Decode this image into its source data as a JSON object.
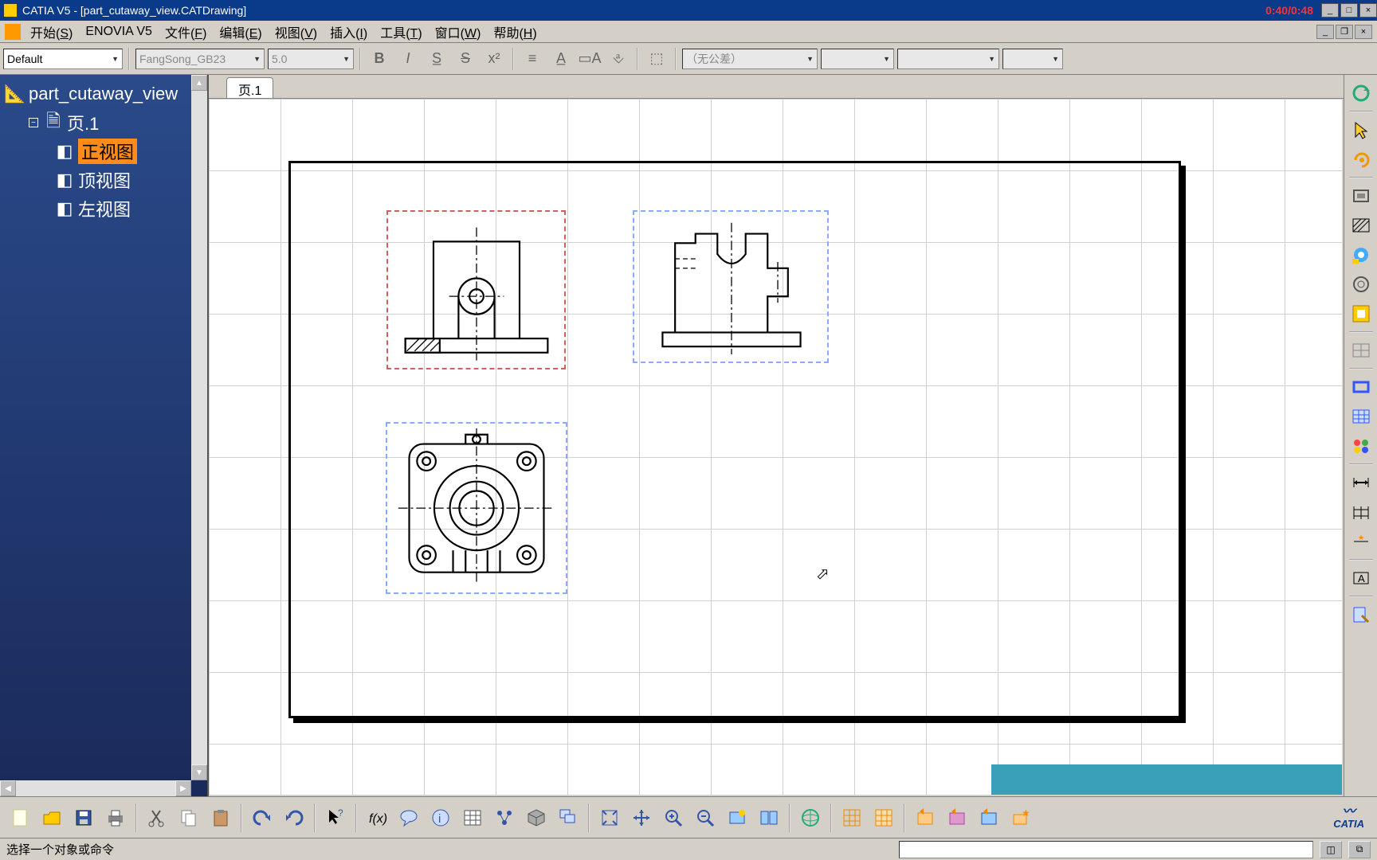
{
  "app": {
    "name": "CATIA V5",
    "document": "[part_cutaway_view.CATDrawing]",
    "timer": "0:40/0:48"
  },
  "menu": {
    "start": {
      "label": "开始",
      "hotkey": "S"
    },
    "enovia": {
      "label": "ENOVIA V5"
    },
    "file": {
      "label": "文件",
      "hotkey": "F"
    },
    "edit": {
      "label": "编辑",
      "hotkey": "E"
    },
    "view": {
      "label": "视图",
      "hotkey": "V"
    },
    "insert": {
      "label": "插入",
      "hotkey": "I"
    },
    "tools": {
      "label": "工具",
      "hotkey": "T"
    },
    "window": {
      "label": "窗口",
      "hotkey": "W"
    },
    "help": {
      "label": "帮助",
      "hotkey": "H"
    }
  },
  "format": {
    "style": "Default",
    "font": "FangSong_GB23",
    "size": "5.0",
    "tolerance": "（无公差）"
  },
  "tree": {
    "root": "part_cutaway_view",
    "sheet": "页.1",
    "views": [
      {
        "label": "正视图",
        "active": true
      },
      {
        "label": "顶视图",
        "active": false
      },
      {
        "label": "左视图",
        "active": false
      }
    ]
  },
  "tabs": {
    "sheet1": "页.1"
  },
  "status": {
    "message": "选择一个对象或命令"
  },
  "logo": "CATIA",
  "right_tools": [
    "update-icon",
    "select-arrow-icon",
    "rotate-icon",
    "view-frame-icon",
    "hatch-pattern-icon",
    "gear-color-icon",
    "gear-outline-icon",
    "projection-icon",
    "grid-display-icon",
    "blue-rect-icon",
    "table-grid-icon",
    "symbols-icon",
    "dimension-icon",
    "chain-dim-icon",
    "auto-dim-icon",
    "text-box-icon",
    "edit-sheet-icon"
  ],
  "bottom_tools": [
    "new-icon",
    "open-icon",
    "save-icon",
    "print-icon",
    "cut-icon",
    "copy-icon",
    "paste-icon",
    "undo-icon",
    "redo-icon",
    "help-pointer-icon",
    "fx-icon",
    "comment-icon",
    "info-icon",
    "spreadsheet-icon",
    "tree-link-icon",
    "package-icon",
    "cascade-icon",
    "fit-all-icon",
    "pan-icon",
    "zoom-in-icon",
    "zoom-out-icon",
    "normal-view-icon",
    "multi-view-icon",
    "web-icon",
    "grid-orange1-icon",
    "grid-orange2-icon",
    "sketch-orange-icon",
    "sketch-purple-icon",
    "sketch-blue-icon",
    "sketch-star-icon"
  ]
}
